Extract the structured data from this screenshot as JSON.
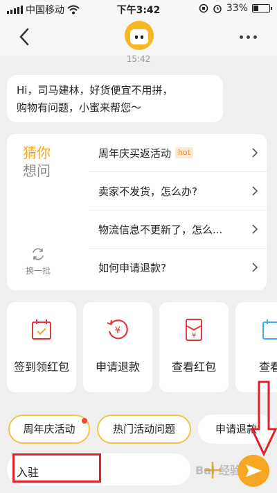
{
  "status_bar": {
    "carrier": "中国移动",
    "time": "下午3:42",
    "battery_percent": "33%",
    "battery_level": 0.33
  },
  "chat": {
    "timestamp": "15:42",
    "greeting_line1": "Hi，司马建林，好货便宜不用拼，",
    "greeting_line2": "购物有问题，小蜜来帮您～"
  },
  "guess": {
    "title_part1": "猜你",
    "title_part2": "想问",
    "refresh_label": "换一批",
    "questions": [
      {
        "label": "周年庆买返活动",
        "badge": "hot"
      },
      {
        "label": "卖家不发货，怎么办?"
      },
      {
        "label": "物流信息不更新了，怎么..."
      },
      {
        "label": "如何申请退款?"
      }
    ]
  },
  "shortcuts": [
    {
      "label": "签到领红包",
      "icon": "calendar-check-icon"
    },
    {
      "label": "申请退款",
      "icon": "refund-yen-icon"
    },
    {
      "label": "查看红包",
      "icon": "red-envelope-icon"
    },
    {
      "label": "查看",
      "icon": "calendar-icon"
    }
  ],
  "quick_pills": [
    {
      "label": "周年庆活动",
      "has_dot": true
    },
    {
      "label": "热门活动问题",
      "has_dot": false
    },
    {
      "label": "申请退款",
      "has_dot": false
    }
  ],
  "input": {
    "value": "入驻"
  },
  "watermark": "Bai 经验",
  "colors": {
    "accent": "#f5a623",
    "pill_border": "#f3c546",
    "annotation": "#e0202a",
    "icon_red": "#e0383e"
  }
}
